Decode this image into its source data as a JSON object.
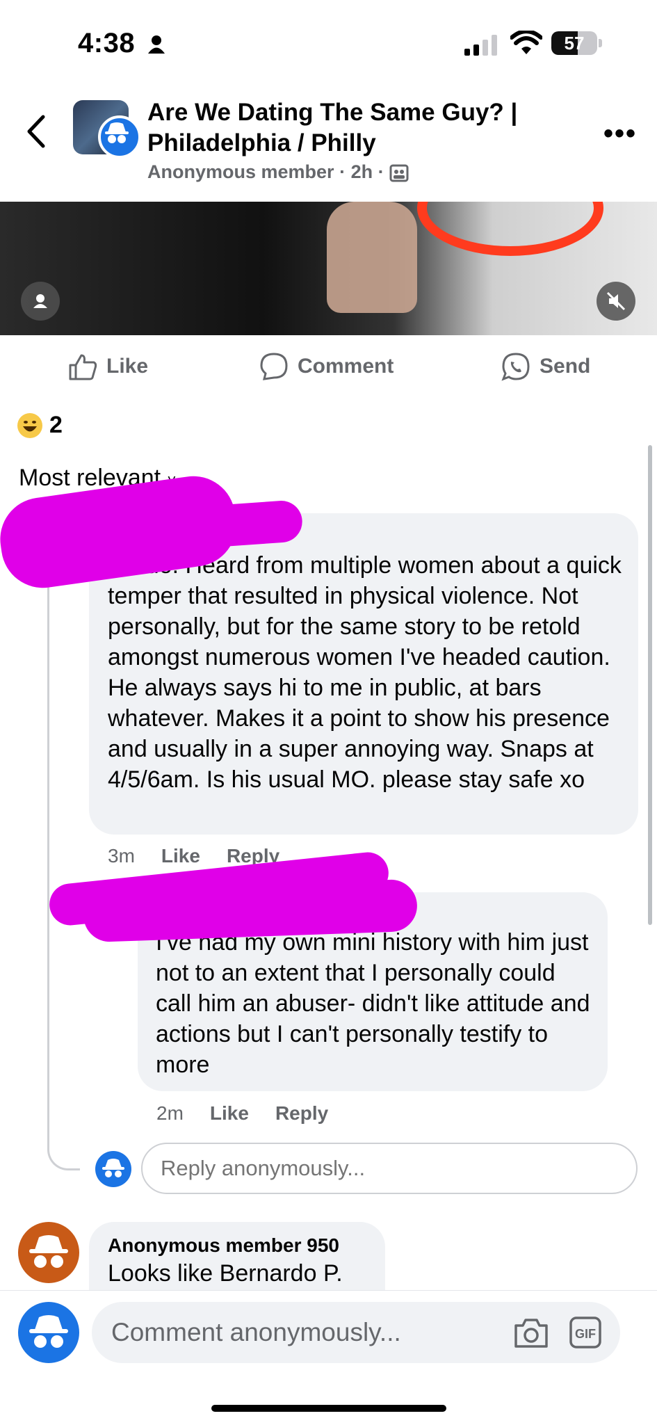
{
  "status": {
    "time": "4:38",
    "battery": "57",
    "battery_level": 0.57
  },
  "header": {
    "title": "Are We Dating The Same Guy? | Philadelphia / Philly",
    "author": "Anonymous member",
    "time": "2h"
  },
  "actions": {
    "like": "Like",
    "comment": "Comment",
    "send": "Send"
  },
  "reactions": {
    "count": "2"
  },
  "sort": {
    "label": "Most relevant"
  },
  "comments": [
    {
      "text": "Nardo. Heard from multiple women about a quick temper that resulted in physical violence. Not personally, but for the same story to be retold amongst numerous women I've headed caution. He always says hi to me in public, at bars whatever. Makes it a point to show his presence and usually in a super annoying way. Snaps at 4/5/6am. Is his usual MO. please stay safe xo",
      "time": "3m",
      "like": "Like",
      "reply": "Reply"
    },
    {
      "text": "I've had my own mini history with him just not to an extent that I personally could call him an abuser- didn't like attitude and actions but I can't personally testify to more",
      "time": "2m",
      "like": "Like",
      "reply": "Reply"
    },
    {
      "author": "Anonymous member 950",
      "text": "Looks like Bernardo P."
    }
  ],
  "reply_box": {
    "placeholder": "Reply anonymously..."
  },
  "composer": {
    "placeholder": "Comment anonymously..."
  },
  "icons": [
    "back-icon",
    "more-icon",
    "like-icon",
    "comment-icon",
    "whatsapp-icon",
    "camera-icon",
    "gif-icon",
    "mute-icon",
    "anonymous-icon"
  ]
}
